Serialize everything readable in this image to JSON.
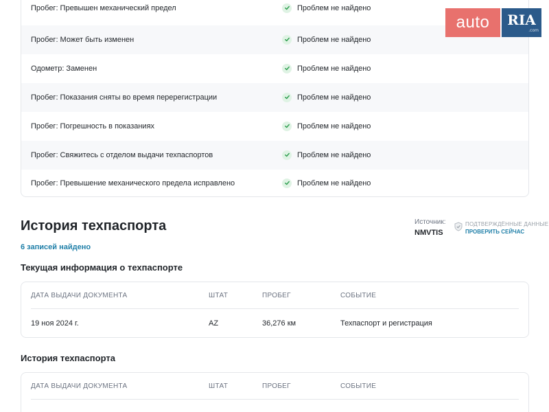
{
  "checks": [
    {
      "label": "Пробег: Превышен механический предел",
      "status": "Проблем не найдено"
    },
    {
      "label": "Пробег: Может быть изменен",
      "status": "Проблем не найдено"
    },
    {
      "label": "Одометр: Заменен",
      "status": "Проблем не найдено"
    },
    {
      "label": "Пробег: Показания сняты во время перерегистрации",
      "status": "Проблем не найдено"
    },
    {
      "label": "Пробег: Погрешность в показаниях",
      "status": "Проблем не найдено"
    },
    {
      "label": "Пробег: Свяжитесь с отделом выдачи техпаспортов",
      "status": "Проблем не найдено"
    },
    {
      "label": "Пробег: Превышение механического предела исправлено",
      "status": "Проблем не найдено"
    }
  ],
  "logo": {
    "auto": "auto",
    "ria": "RIA",
    "ria_sub": ".com"
  },
  "title_history": {
    "title": "История техпаспорта",
    "records_found": "6 записей найдено",
    "source_label": "Источник:",
    "source_value": "NMVTIS",
    "verified_text": "ПОДТВЕРЖДЁННЫЕ ДАННЫЕ",
    "verify_link": "ПРОВЕРИТЬ СЕЙЧАС"
  },
  "current_info": {
    "heading": "Текущая информация о техпаспорте",
    "columns": [
      "ДАТА ВЫДАЧИ ДОКУМЕНТА",
      "ШТАТ",
      "ПРОБЕГ",
      "СОБЫТИЕ"
    ],
    "row": {
      "date": "19 ноя 2024 г.",
      "state": "AZ",
      "mileage": "36,276 км",
      "event": "Техпаспорт и регистрация"
    }
  },
  "history": {
    "heading": "История техпаспорта",
    "columns": [
      "ДАТА ВЫДАЧИ ДОКУМЕНТА",
      "ШТАТ",
      "ПРОБЕГ",
      "СОБЫТИЕ"
    ]
  },
  "colors": {
    "accent": "#1f7fa8",
    "ok_green": "#2e9e4f",
    "logo_red": "#e8716d",
    "logo_blue": "#2b5a8a"
  },
  "icons": {
    "check": "check-circle-icon",
    "shield": "shield-icon"
  }
}
